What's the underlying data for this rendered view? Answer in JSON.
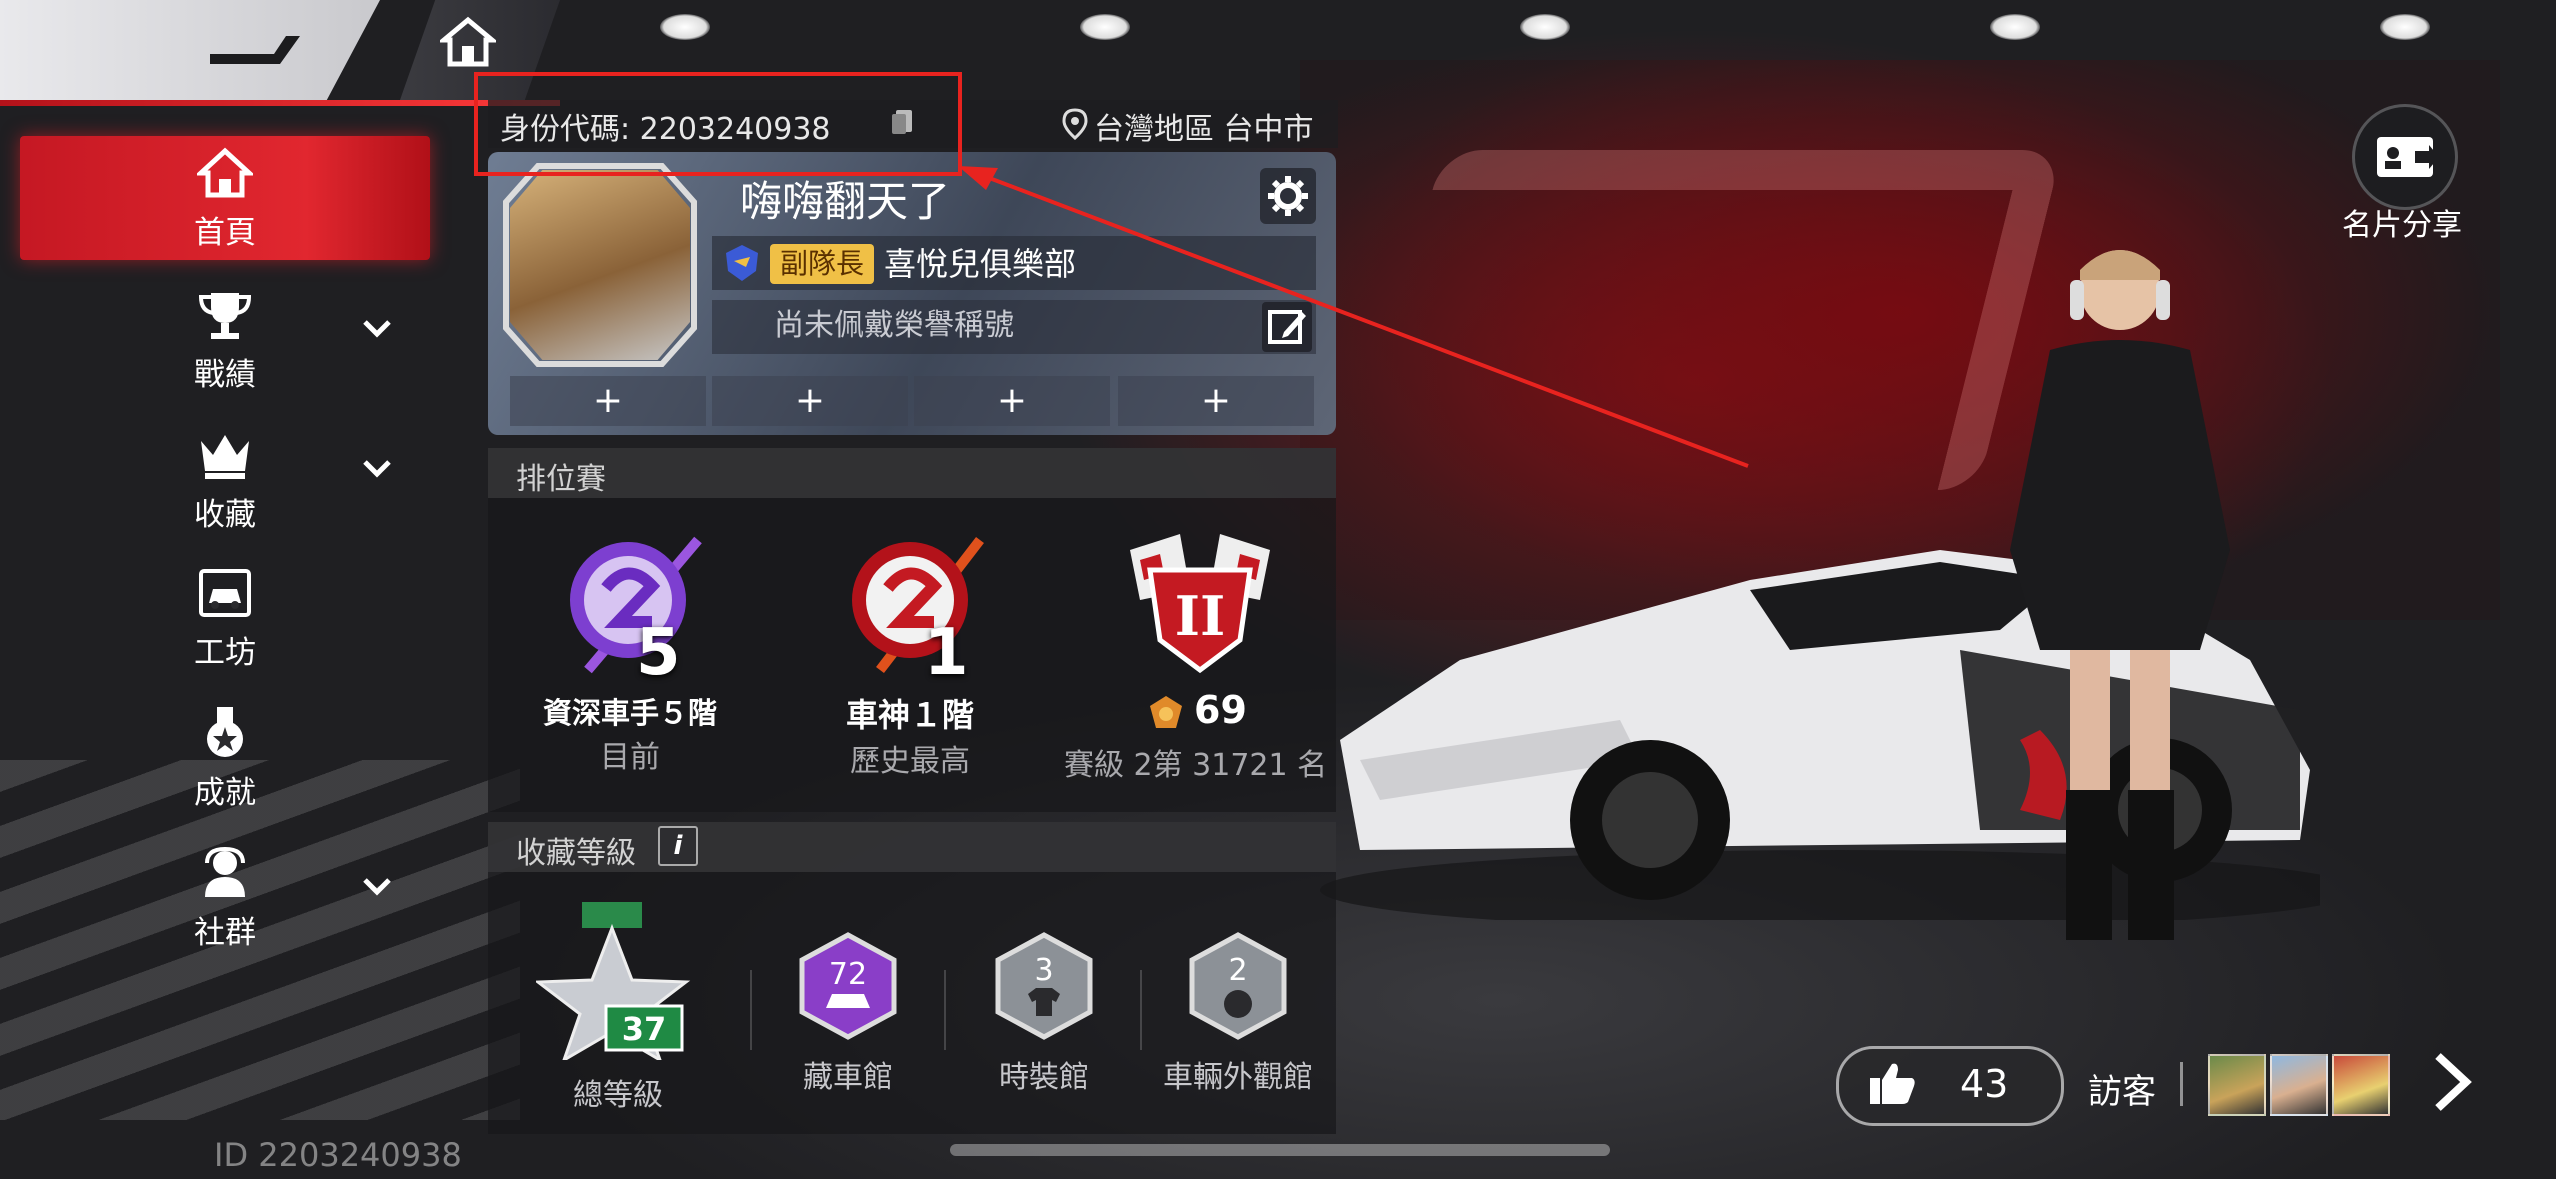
{
  "profile": {
    "id_label": "身份代碼: 2203240938",
    "location": "台灣地區 台中市",
    "name": "嗨嗨翻天了",
    "club_role": "副隊長",
    "club_name": "喜悅兒俱樂部",
    "honor_title": "尚未佩戴榮譽稱號",
    "slot_label": "+"
  },
  "sidebar": {
    "items": [
      {
        "label": "首頁",
        "icon": "home-icon",
        "active": true
      },
      {
        "label": "戰績",
        "icon": "trophy-icon",
        "expandable": true
      },
      {
        "label": "收藏",
        "icon": "crown-icon",
        "expandable": true
      },
      {
        "label": "工坊",
        "icon": "garage-car-icon"
      },
      {
        "label": "成就",
        "icon": "medal-icon"
      },
      {
        "label": "社群",
        "icon": "community-icon",
        "expandable": true
      }
    ]
  },
  "ranked": {
    "title": "排位賽",
    "current": {
      "tier_num": "5",
      "name": "資深車手５階",
      "sub": "目前"
    },
    "best": {
      "tier_num": "1",
      "name": "車神１階",
      "sub": "歷史最高"
    },
    "season": {
      "points": "69",
      "sub": "賽級 2第 31721 名",
      "roman": "II"
    }
  },
  "collection": {
    "title": "收藏等級",
    "info_icon": "i",
    "overall": {
      "level": "37",
      "label": "總等級"
    },
    "halls": [
      {
        "level": "72",
        "label": "藏車館",
        "color": "#8a3ec8"
      },
      {
        "level": "3",
        "label": "時裝館",
        "color": "#8c9197"
      },
      {
        "level": "2",
        "label": "車輛外觀館",
        "color": "#8c9197"
      }
    ]
  },
  "footer": {
    "id_text": "ID 2203240938"
  },
  "social": {
    "share_label": "名片分享",
    "likes": "43",
    "visitors_label": "訪客"
  },
  "colors": {
    "accent": "#e1272f",
    "highlight": "#e8231f",
    "badge": "#f0c046"
  }
}
